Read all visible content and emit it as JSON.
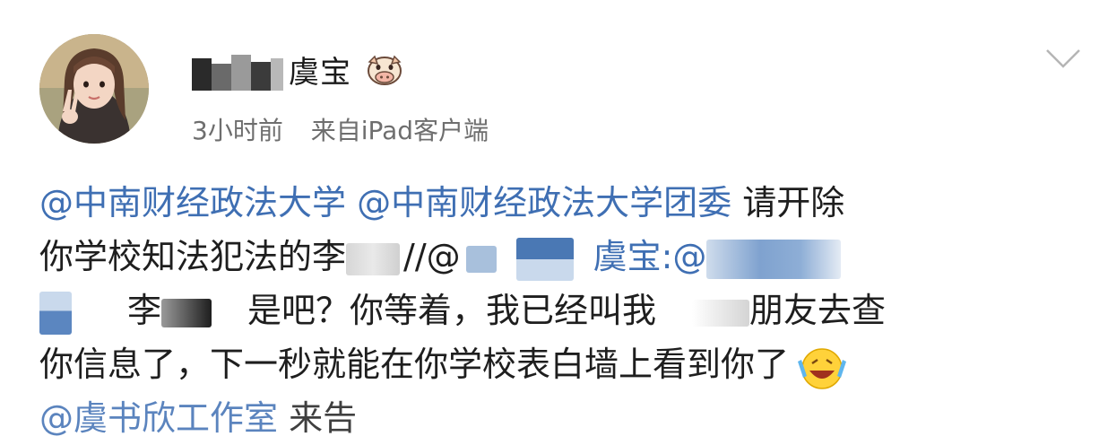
{
  "post": {
    "author": {
      "name": "虞宝",
      "avatar": "avatar-photo",
      "badge": "cow-face-icon"
    },
    "meta": {
      "time": "3小时前",
      "source": "来自iPad客户端"
    },
    "body": {
      "line1": {
        "mention1": "@中南财经政法大学",
        "mention2": "@中南财经政法大学团委",
        "text": "请开除"
      },
      "line2": {
        "text": "你学校知法犯法的李",
        "slashes": "//@",
        "mention": "虞宝:@"
      },
      "line3": {
        "name_prefix": "李",
        "text1": "是吧？你等着，我已经叫我",
        "text2": "朋友去查"
      },
      "line4": {
        "text": "你信息了，下一秒就能在你学校表白墙上看到你了",
        "emoji": "laughing-crying-emoji"
      },
      "line5": {
        "mention": "@虞书欣工作室",
        "text": "来告"
      }
    }
  },
  "colors": {
    "mention": "#3f6fb3",
    "text": "#1e1e1e",
    "meta": "#6e6e6e",
    "background": "#ffffff"
  }
}
